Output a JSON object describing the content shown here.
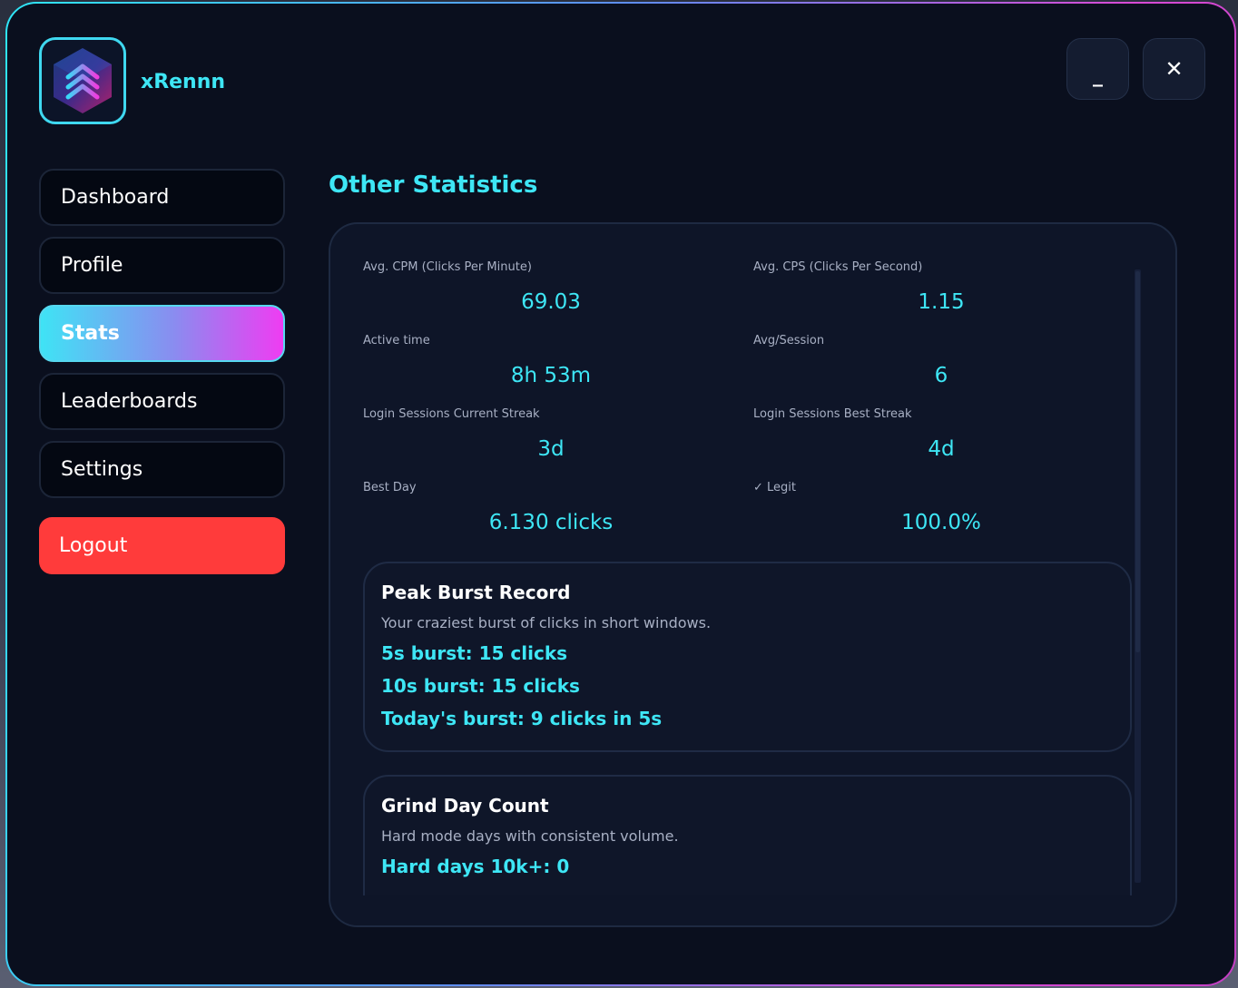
{
  "header": {
    "username": "xRennn",
    "minimize_label": "_",
    "close_label": "✕"
  },
  "sidebar": {
    "items": [
      {
        "label": "Dashboard"
      },
      {
        "label": "Profile"
      },
      {
        "label": "Stats"
      },
      {
        "label": "Leaderboards"
      },
      {
        "label": "Settings"
      }
    ],
    "logout_label": "Logout",
    "active": "Stats"
  },
  "main": {
    "title": "Other Statistics",
    "stats": [
      {
        "label": "Avg. CPM (Clicks Per Minute)",
        "value": "69.03"
      },
      {
        "label": "Avg. CPS (Clicks Per Second)",
        "value": "1.15"
      },
      {
        "label": "Active time",
        "value": "8h 53m"
      },
      {
        "label": "Avg/Session",
        "value": "6"
      },
      {
        "label": "Login Sessions Current Streak",
        "value": "3d"
      },
      {
        "label": "Login Sessions Best Streak",
        "value": "4d"
      },
      {
        "label": "Best Day",
        "value": "6.130 clicks"
      },
      {
        "label": "✓ Legit",
        "value": "100.0%"
      }
    ],
    "peak_burst": {
      "title": "Peak Burst Record",
      "subtitle": "Your craziest burst of clicks in short windows.",
      "lines": [
        "5s burst: 15 clicks",
        "10s burst: 15 clicks",
        "Today's burst: 9 clicks in 5s"
      ]
    },
    "grind": {
      "title": "Grind Day Count",
      "subtitle": "Hard mode days with consistent volume.",
      "lines": [
        "Hard days 10k+: 0"
      ]
    }
  },
  "colors": {
    "accent": "#3ee6f5",
    "background": "#0a0f1e",
    "logout": "#ff3b3b",
    "active_gradient_start": "#3fe3f5",
    "active_gradient_end": "#ef3cf2"
  },
  "icons": {
    "logo": "chevron-up-stack-logo-icon"
  }
}
